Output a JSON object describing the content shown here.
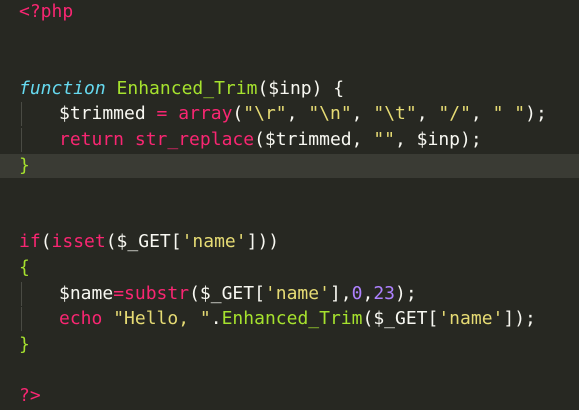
{
  "editor": {
    "lines": [
      {
        "tokens": [
          {
            "c": "tag",
            "t": "<?php"
          }
        ]
      },
      {
        "tokens": []
      },
      {
        "tokens": []
      },
      {
        "tokens": [
          {
            "c": "ty",
            "t": "function"
          },
          {
            "c": "pl",
            "t": " "
          },
          {
            "c": "fn",
            "t": "Enhanced_Trim"
          },
          {
            "c": "pl",
            "t": "($inp) {"
          }
        ]
      },
      {
        "indent": 1,
        "tokens": [
          {
            "c": "pl",
            "t": "$trimmed "
          },
          {
            "c": "kw",
            "t": "="
          },
          {
            "c": "pl",
            "t": " "
          },
          {
            "c": "kw",
            "t": "array"
          },
          {
            "c": "pl",
            "t": "("
          },
          {
            "c": "st",
            "t": "\"\\r\""
          },
          {
            "c": "pl",
            "t": ", "
          },
          {
            "c": "st",
            "t": "\"\\n\""
          },
          {
            "c": "pl",
            "t": ", "
          },
          {
            "c": "st",
            "t": "\"\\t\""
          },
          {
            "c": "pl",
            "t": ", "
          },
          {
            "c": "st",
            "t": "\"/\""
          },
          {
            "c": "pl",
            "t": ", "
          },
          {
            "c": "st",
            "t": "\" \""
          },
          {
            "c": "pl",
            "t": ");"
          }
        ]
      },
      {
        "indent": 1,
        "tokens": [
          {
            "c": "kw",
            "t": "return"
          },
          {
            "c": "pl",
            "t": " "
          },
          {
            "c": "kw",
            "t": "str_replace"
          },
          {
            "c": "pl",
            "t": "($trimmed, "
          },
          {
            "c": "st",
            "t": "\"\""
          },
          {
            "c": "pl",
            "t": ", $inp);"
          }
        ]
      },
      {
        "active": true,
        "tokens": [
          {
            "c": "cur",
            "t": "}"
          }
        ]
      },
      {
        "tokens": []
      },
      {
        "tokens": []
      },
      {
        "tokens": [
          {
            "c": "kw",
            "t": "if"
          },
          {
            "c": "pl",
            "t": "("
          },
          {
            "c": "kw",
            "t": "isset"
          },
          {
            "c": "pl",
            "t": "($_GET["
          },
          {
            "c": "st",
            "t": "'name'"
          },
          {
            "c": "pl",
            "t": "]))"
          }
        ]
      },
      {
        "tokens": [
          {
            "c": "cur",
            "t": "{"
          }
        ]
      },
      {
        "indent": 1,
        "tokens": [
          {
            "c": "pl",
            "t": "$name"
          },
          {
            "c": "kw",
            "t": "="
          },
          {
            "c": "kw",
            "t": "substr"
          },
          {
            "c": "pl",
            "t": "($_GET["
          },
          {
            "c": "st",
            "t": "'name'"
          },
          {
            "c": "pl",
            "t": "],"
          },
          {
            "c": "nu",
            "t": "0"
          },
          {
            "c": "pl",
            "t": ","
          },
          {
            "c": "nu",
            "t": "23"
          },
          {
            "c": "pl",
            "t": ");"
          }
        ]
      },
      {
        "indent": 1,
        "tokens": [
          {
            "c": "kw",
            "t": "echo"
          },
          {
            "c": "pl",
            "t": " "
          },
          {
            "c": "st",
            "t": "\"Hello, \""
          },
          {
            "c": "pl",
            "t": "."
          },
          {
            "c": "fn",
            "t": "Enhanced_Trim"
          },
          {
            "c": "pl",
            "t": "($_GET["
          },
          {
            "c": "st",
            "t": "'name'"
          },
          {
            "c": "pl",
            "t": "]);"
          }
        ]
      },
      {
        "tokens": [
          {
            "c": "cur",
            "t": "}"
          }
        ]
      },
      {
        "tokens": []
      },
      {
        "tokens": [
          {
            "c": "tag",
            "t": "?>"
          }
        ]
      }
    ]
  }
}
